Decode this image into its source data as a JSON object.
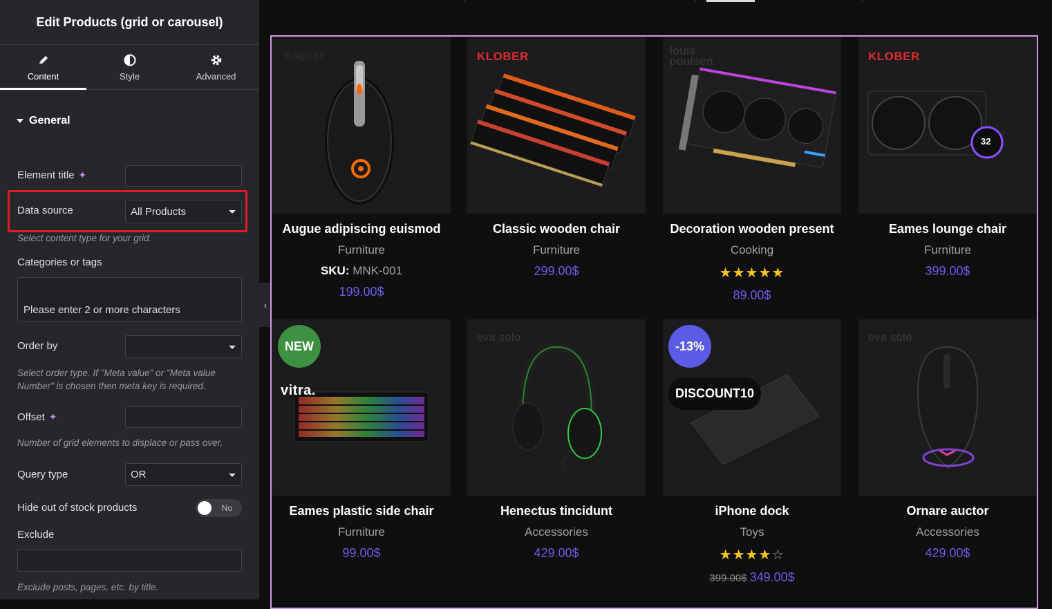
{
  "panel": {
    "title": "Edit Products (grid or carousel)",
    "tabs": [
      {
        "label": "Content",
        "icon": "pencil-icon"
      },
      {
        "label": "Style",
        "icon": "half-circle-icon"
      },
      {
        "label": "Advanced",
        "icon": "gear-icon"
      }
    ],
    "section": "General",
    "fields": {
      "element_title": {
        "label": "Element title",
        "value": ""
      },
      "data_source": {
        "label": "Data source",
        "value": "All Products",
        "hint": "Select content type for your grid."
      },
      "categories": {
        "label": "Categories or tags",
        "value": "",
        "suggestion": "Please enter 2 or more characters"
      },
      "order_by": {
        "label": "Order by",
        "value": "",
        "hint": "Select order type. If \"Meta value\" or \"Meta value Number\" is chosen then meta key is required."
      },
      "offset": {
        "label": "Offset",
        "value": "",
        "hint": "Number of grid elements to displace or pass over."
      },
      "query_type": {
        "label": "Query type",
        "value": "OR"
      },
      "hide_out_of_stock": {
        "label": "Hide out of stock products",
        "toggle": "No"
      },
      "exclude": {
        "label": "Exclude",
        "value": "",
        "hint": "Exclude posts, pages, etc. by title."
      }
    }
  },
  "products": [
    {
      "title": "Augue adipiscing euismod",
      "category": "Furniture",
      "sku_label": "SKU:",
      "sku": "MNK-001",
      "price": "199.00$",
      "brand": "magisso"
    },
    {
      "title": "Classic wooden chair",
      "category": "Furniture",
      "price": "299.00$",
      "brand": "KLOBER"
    },
    {
      "title": "Decoration wooden present",
      "category": "Cooking",
      "rating": "★★★★★",
      "price": "89.00$",
      "brand": "louis poulsen"
    },
    {
      "title": "Eames lounge chair",
      "category": "Furniture",
      "price": "399.00$",
      "brand": "KLOBER"
    },
    {
      "title": "Eames plastic side chair",
      "category": "Furniture",
      "price": "99.00$",
      "badge": "NEW",
      "brand": "vitra."
    },
    {
      "title": "Henectus tincidunt",
      "category": "Accessories",
      "price": "429.00$",
      "brand": "eva solo"
    },
    {
      "title": "iPhone dock",
      "category": "Toys",
      "rating_full": "★★★★",
      "rating_empty": "☆",
      "old_price": "399.00$",
      "price": "349.00$",
      "badge": "-13%",
      "coupon": "DISCOUNT10"
    },
    {
      "title": "Ornare auctor",
      "category": "Accessories",
      "price": "429.00$",
      "brand": "eva solo"
    }
  ],
  "colors": {
    "accent": "#6c5ce7",
    "highlight": "#e01b24",
    "frame": "#d79be6",
    "new_badge": "#3f9142",
    "sale_badge": "#5b5be6"
  },
  "misc": {
    "aio_water": "32"
  }
}
